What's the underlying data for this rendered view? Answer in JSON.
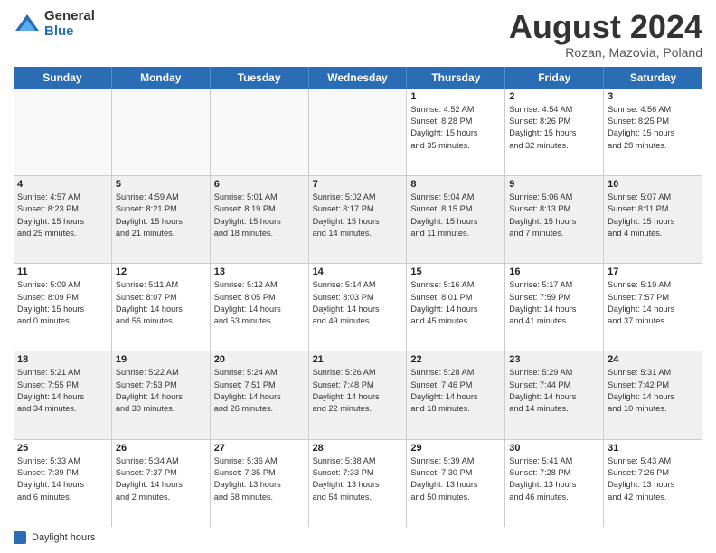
{
  "header": {
    "logo_general": "General",
    "logo_blue": "Blue",
    "month_year": "August 2024",
    "location": "Rozan, Mazovia, Poland"
  },
  "days_of_week": [
    "Sunday",
    "Monday",
    "Tuesday",
    "Wednesday",
    "Thursday",
    "Friday",
    "Saturday"
  ],
  "weeks": [
    [
      {
        "day": "",
        "info": ""
      },
      {
        "day": "",
        "info": ""
      },
      {
        "day": "",
        "info": ""
      },
      {
        "day": "",
        "info": ""
      },
      {
        "day": "1",
        "info": "Sunrise: 4:52 AM\nSunset: 8:28 PM\nDaylight: 15 hours\nand 35 minutes."
      },
      {
        "day": "2",
        "info": "Sunrise: 4:54 AM\nSunset: 8:26 PM\nDaylight: 15 hours\nand 32 minutes."
      },
      {
        "day": "3",
        "info": "Sunrise: 4:56 AM\nSunset: 8:25 PM\nDaylight: 15 hours\nand 28 minutes."
      }
    ],
    [
      {
        "day": "4",
        "info": "Sunrise: 4:57 AM\nSunset: 8:23 PM\nDaylight: 15 hours\nand 25 minutes."
      },
      {
        "day": "5",
        "info": "Sunrise: 4:59 AM\nSunset: 8:21 PM\nDaylight: 15 hours\nand 21 minutes."
      },
      {
        "day": "6",
        "info": "Sunrise: 5:01 AM\nSunset: 8:19 PM\nDaylight: 15 hours\nand 18 minutes."
      },
      {
        "day": "7",
        "info": "Sunrise: 5:02 AM\nSunset: 8:17 PM\nDaylight: 15 hours\nand 14 minutes."
      },
      {
        "day": "8",
        "info": "Sunrise: 5:04 AM\nSunset: 8:15 PM\nDaylight: 15 hours\nand 11 minutes."
      },
      {
        "day": "9",
        "info": "Sunrise: 5:06 AM\nSunset: 8:13 PM\nDaylight: 15 hours\nand 7 minutes."
      },
      {
        "day": "10",
        "info": "Sunrise: 5:07 AM\nSunset: 8:11 PM\nDaylight: 15 hours\nand 4 minutes."
      }
    ],
    [
      {
        "day": "11",
        "info": "Sunrise: 5:09 AM\nSunset: 8:09 PM\nDaylight: 15 hours\nand 0 minutes."
      },
      {
        "day": "12",
        "info": "Sunrise: 5:11 AM\nSunset: 8:07 PM\nDaylight: 14 hours\nand 56 minutes."
      },
      {
        "day": "13",
        "info": "Sunrise: 5:12 AM\nSunset: 8:05 PM\nDaylight: 14 hours\nand 53 minutes."
      },
      {
        "day": "14",
        "info": "Sunrise: 5:14 AM\nSunset: 8:03 PM\nDaylight: 14 hours\nand 49 minutes."
      },
      {
        "day": "15",
        "info": "Sunrise: 5:16 AM\nSunset: 8:01 PM\nDaylight: 14 hours\nand 45 minutes."
      },
      {
        "day": "16",
        "info": "Sunrise: 5:17 AM\nSunset: 7:59 PM\nDaylight: 14 hours\nand 41 minutes."
      },
      {
        "day": "17",
        "info": "Sunrise: 5:19 AM\nSunset: 7:57 PM\nDaylight: 14 hours\nand 37 minutes."
      }
    ],
    [
      {
        "day": "18",
        "info": "Sunrise: 5:21 AM\nSunset: 7:55 PM\nDaylight: 14 hours\nand 34 minutes."
      },
      {
        "day": "19",
        "info": "Sunrise: 5:22 AM\nSunset: 7:53 PM\nDaylight: 14 hours\nand 30 minutes."
      },
      {
        "day": "20",
        "info": "Sunrise: 5:24 AM\nSunset: 7:51 PM\nDaylight: 14 hours\nand 26 minutes."
      },
      {
        "day": "21",
        "info": "Sunrise: 5:26 AM\nSunset: 7:48 PM\nDaylight: 14 hours\nand 22 minutes."
      },
      {
        "day": "22",
        "info": "Sunrise: 5:28 AM\nSunset: 7:46 PM\nDaylight: 14 hours\nand 18 minutes."
      },
      {
        "day": "23",
        "info": "Sunrise: 5:29 AM\nSunset: 7:44 PM\nDaylight: 14 hours\nand 14 minutes."
      },
      {
        "day": "24",
        "info": "Sunrise: 5:31 AM\nSunset: 7:42 PM\nDaylight: 14 hours\nand 10 minutes."
      }
    ],
    [
      {
        "day": "25",
        "info": "Sunrise: 5:33 AM\nSunset: 7:39 PM\nDaylight: 14 hours\nand 6 minutes."
      },
      {
        "day": "26",
        "info": "Sunrise: 5:34 AM\nSunset: 7:37 PM\nDaylight: 14 hours\nand 2 minutes."
      },
      {
        "day": "27",
        "info": "Sunrise: 5:36 AM\nSunset: 7:35 PM\nDaylight: 13 hours\nand 58 minutes."
      },
      {
        "day": "28",
        "info": "Sunrise: 5:38 AM\nSunset: 7:33 PM\nDaylight: 13 hours\nand 54 minutes."
      },
      {
        "day": "29",
        "info": "Sunrise: 5:39 AM\nSunset: 7:30 PM\nDaylight: 13 hours\nand 50 minutes."
      },
      {
        "day": "30",
        "info": "Sunrise: 5:41 AM\nSunset: 7:28 PM\nDaylight: 13 hours\nand 46 minutes."
      },
      {
        "day": "31",
        "info": "Sunrise: 5:43 AM\nSunset: 7:26 PM\nDaylight: 13 hours\nand 42 minutes."
      }
    ]
  ],
  "footer": {
    "legend_label": "Daylight hours"
  }
}
